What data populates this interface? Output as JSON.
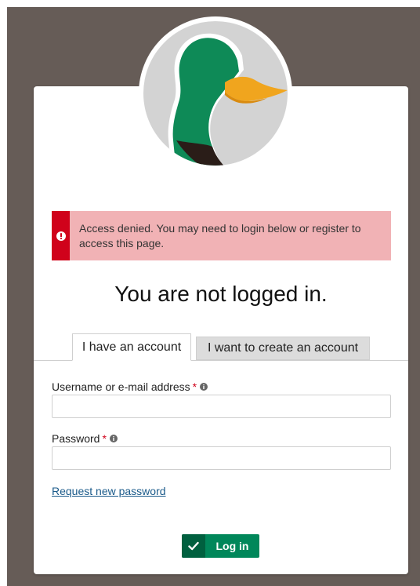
{
  "alert": {
    "message": "Access denied. You may need to login below or register to access this page.",
    "color": "#d0021b",
    "background": "#f1b2b5"
  },
  "page": {
    "title": "You are not logged in."
  },
  "tabs": [
    {
      "label": "I have an account",
      "active": true
    },
    {
      "label": "I want to create an account",
      "active": false
    }
  ],
  "form": {
    "username": {
      "label": "Username or e-mail address",
      "required_mark": "*",
      "value": "",
      "placeholder": ""
    },
    "password": {
      "label": "Password",
      "required_mark": "*",
      "value": "",
      "placeholder": ""
    },
    "reset_link": "Request new password",
    "submit_label": "Log in"
  },
  "colors": {
    "backdrop": "#665c57",
    "accent": "#00875a",
    "link": "#1a5a8a",
    "required": "#d0021b"
  },
  "icons": {
    "logo": "duck-head-logo",
    "alert": "exclamation-icon",
    "field_help": "info-icon",
    "submit": "checkmark-icon"
  }
}
